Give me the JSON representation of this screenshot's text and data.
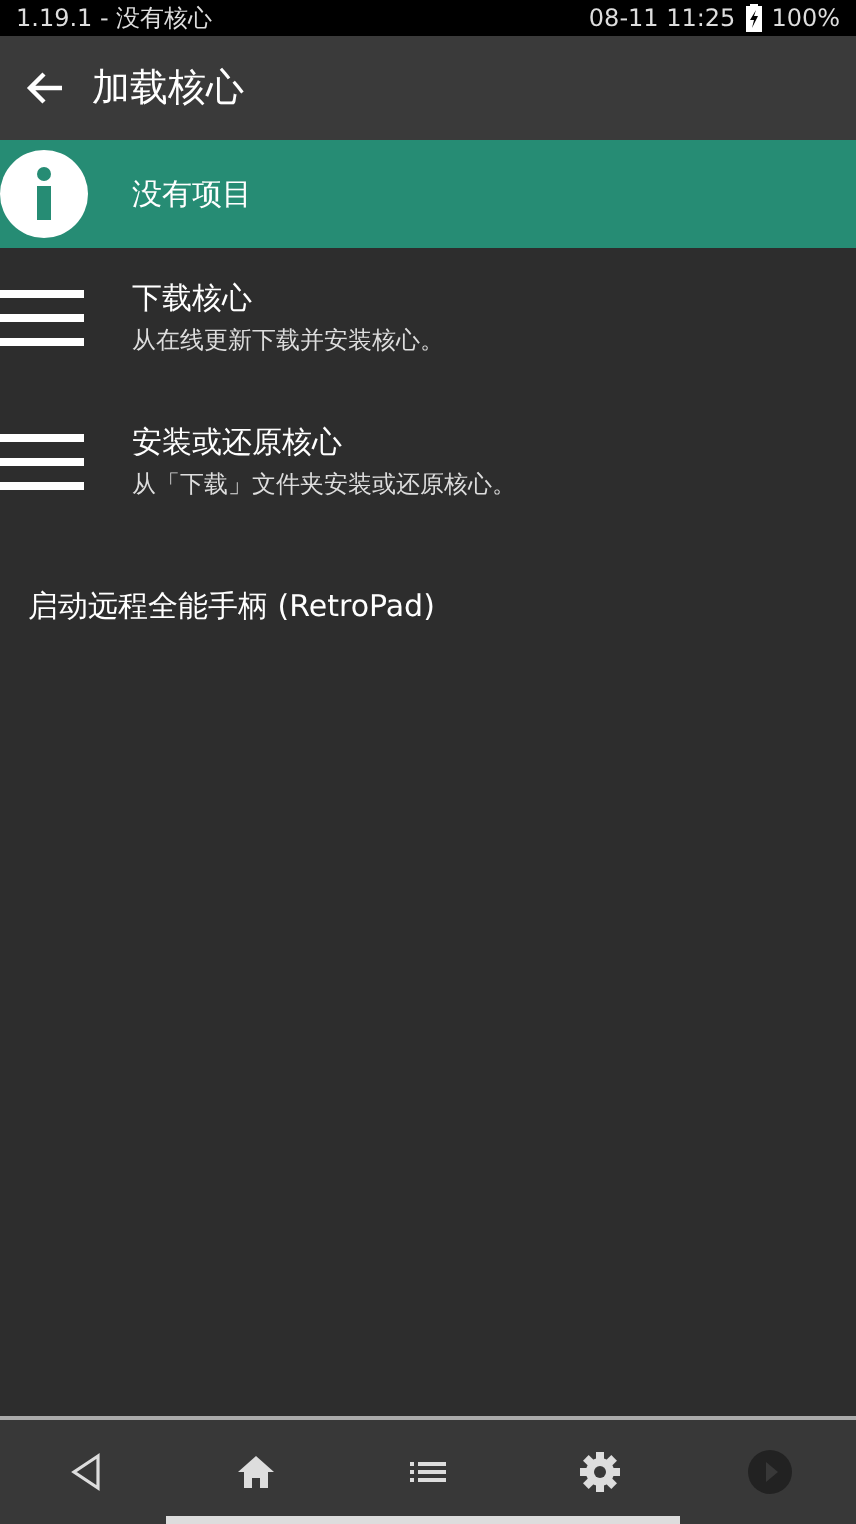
{
  "status_bar": {
    "left": "1.19.1 - 没有核心",
    "time": "08-11 11:25",
    "battery": "100%"
  },
  "header": {
    "title": "加载核心"
  },
  "items": [
    {
      "kind": "info",
      "label": "没有项目",
      "selected": true
    },
    {
      "kind": "lines",
      "label": "下载核心",
      "sublabel": "从在线更新下载并安装核心。",
      "selected": false
    },
    {
      "kind": "lines",
      "label": "安装或还原核心",
      "sublabel": "从「下载」文件夹安装或还原核心。",
      "selected": false
    },
    {
      "kind": "plain",
      "label": "启动远程全能手柄 (RetroPad)",
      "selected": false
    }
  ],
  "nav": [
    {
      "kind": "back",
      "disabled": false
    },
    {
      "kind": "home",
      "disabled": false
    },
    {
      "kind": "list",
      "disabled": false
    },
    {
      "kind": "settings",
      "disabled": false
    },
    {
      "kind": "play",
      "disabled": true
    }
  ]
}
